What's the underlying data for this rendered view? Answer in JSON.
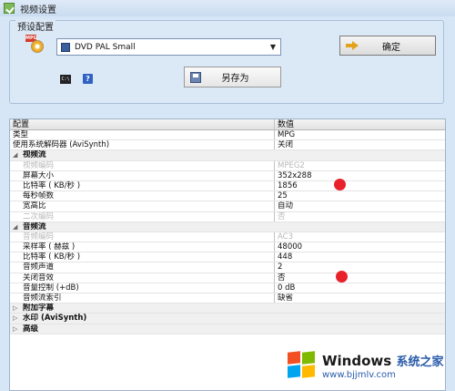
{
  "window": {
    "title": "视频设置"
  },
  "preset": {
    "group_label": "预设配置",
    "icon_tag": "MPG",
    "selected": "DVD PAL Small",
    "ok_label": "确定",
    "saveas_label": "另存为",
    "cmd_icon_text": "C:\\",
    "help_icon_text": "?"
  },
  "grid": {
    "header": {
      "name": "配置",
      "value": "数值"
    },
    "rows": [
      {
        "type": "prop",
        "name": "类型",
        "value": "MPG"
      },
      {
        "type": "prop",
        "name": "使用系统解码器 (AviSynth)",
        "value": "关闭"
      },
      {
        "type": "category",
        "name": "视频流",
        "expanded": true
      },
      {
        "type": "prop",
        "name": "视频编码",
        "value": "MPEG2",
        "disabled": true
      },
      {
        "type": "prop",
        "name": "屏幕大小",
        "value": "352x288"
      },
      {
        "type": "prop",
        "name": "比特率 ( KB/秒 )",
        "value": "1856"
      },
      {
        "type": "prop",
        "name": "每秒帧数",
        "value": "25"
      },
      {
        "type": "prop",
        "name": "宽高比",
        "value": "自动"
      },
      {
        "type": "prop",
        "name": "二次编码",
        "value": "否",
        "disabled": true
      },
      {
        "type": "category",
        "name": "音频流",
        "expanded": true
      },
      {
        "type": "prop",
        "name": "音频编码",
        "value": "AC3",
        "disabled": true
      },
      {
        "type": "prop",
        "name": "采样率 ( 赫兹 )",
        "value": "48000"
      },
      {
        "type": "prop",
        "name": "比特率 ( KB/秒 )",
        "value": "448"
      },
      {
        "type": "prop",
        "name": "音频声道",
        "value": "2"
      },
      {
        "type": "prop",
        "name": "关闭音效",
        "value": "否"
      },
      {
        "type": "prop",
        "name": "音量控制 (+dB)",
        "value": "0 dB"
      },
      {
        "type": "prop",
        "name": "音频流索引",
        "value": "缺省"
      },
      {
        "type": "category",
        "name": "附加字幕",
        "expanded": false
      },
      {
        "type": "category",
        "name": "水印 (AviSynth)",
        "expanded": false
      },
      {
        "type": "category",
        "name": "高级",
        "expanded": false
      }
    ]
  },
  "markers": {
    "color": "#e8212a"
  },
  "watermark": {
    "brand": "Windows",
    "suffix": "系统之家",
    "url": "www.bjjmlv.com"
  }
}
